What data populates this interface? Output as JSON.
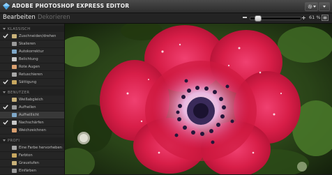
{
  "app": {
    "title": "ADOBE PHOTOSHOP EXPRESS EDITOR",
    "logo_icon": "diamond-logo-icon"
  },
  "tabs": [
    {
      "label": "Bearbeiten",
      "active": true
    },
    {
      "label": "Dekorieren",
      "active": false
    }
  ],
  "zoom": {
    "value": "61 %",
    "level": 0.14
  },
  "sidebar": {
    "sections": [
      {
        "title": "KLASSISCH",
        "items": [
          {
            "label": "Zuschneiden/drehen",
            "checked": true,
            "icon": "crop-icon"
          },
          {
            "label": "Skalieren",
            "checked": false,
            "icon": "resize-icon"
          },
          {
            "label": "Autokorrektur",
            "checked": false,
            "icon": "auto-correct-icon"
          },
          {
            "label": "Belichtung",
            "checked": false,
            "icon": "exposure-icon"
          },
          {
            "label": "Rote Augen",
            "checked": false,
            "icon": "red-eye-icon"
          },
          {
            "label": "Retuschieren",
            "checked": false,
            "icon": "touchup-icon"
          },
          {
            "label": "Sättigung",
            "checked": true,
            "icon": "saturation-icon"
          }
        ]
      },
      {
        "title": "BENUTZER",
        "items": [
          {
            "label": "Weißabgleich",
            "checked": false,
            "icon": "white-balance-icon"
          },
          {
            "label": "Aufhellen",
            "checked": true,
            "icon": "fill-light-icon"
          },
          {
            "label": "Aufhelllicht",
            "checked": false,
            "icon": "highlight-icon",
            "selected": true
          },
          {
            "label": "Nachschärfen",
            "checked": true,
            "icon": "sharpen-icon"
          },
          {
            "label": "Weichzeichnen",
            "checked": false,
            "icon": "soft-focus-icon"
          }
        ]
      },
      {
        "title": "PROFI",
        "items": [
          {
            "label": "Eine Farbe hervorheben",
            "checked": false,
            "icon": "pop-color-icon"
          },
          {
            "label": "Farbton",
            "checked": false,
            "icon": "hue-icon"
          },
          {
            "label": "Graustufen",
            "checked": false,
            "icon": "black-white-icon"
          },
          {
            "label": "Einfärben",
            "checked": false,
            "icon": "tint-icon"
          }
        ]
      }
    ]
  },
  "colors": {
    "check_blue": "#5aaee8",
    "icon_colors": [
      "#c9b27a",
      "#9a9a9a",
      "#7fa8c8",
      "#c8c8c8",
      "#d9a070",
      "#a8a8a8",
      "#c8a860"
    ]
  }
}
